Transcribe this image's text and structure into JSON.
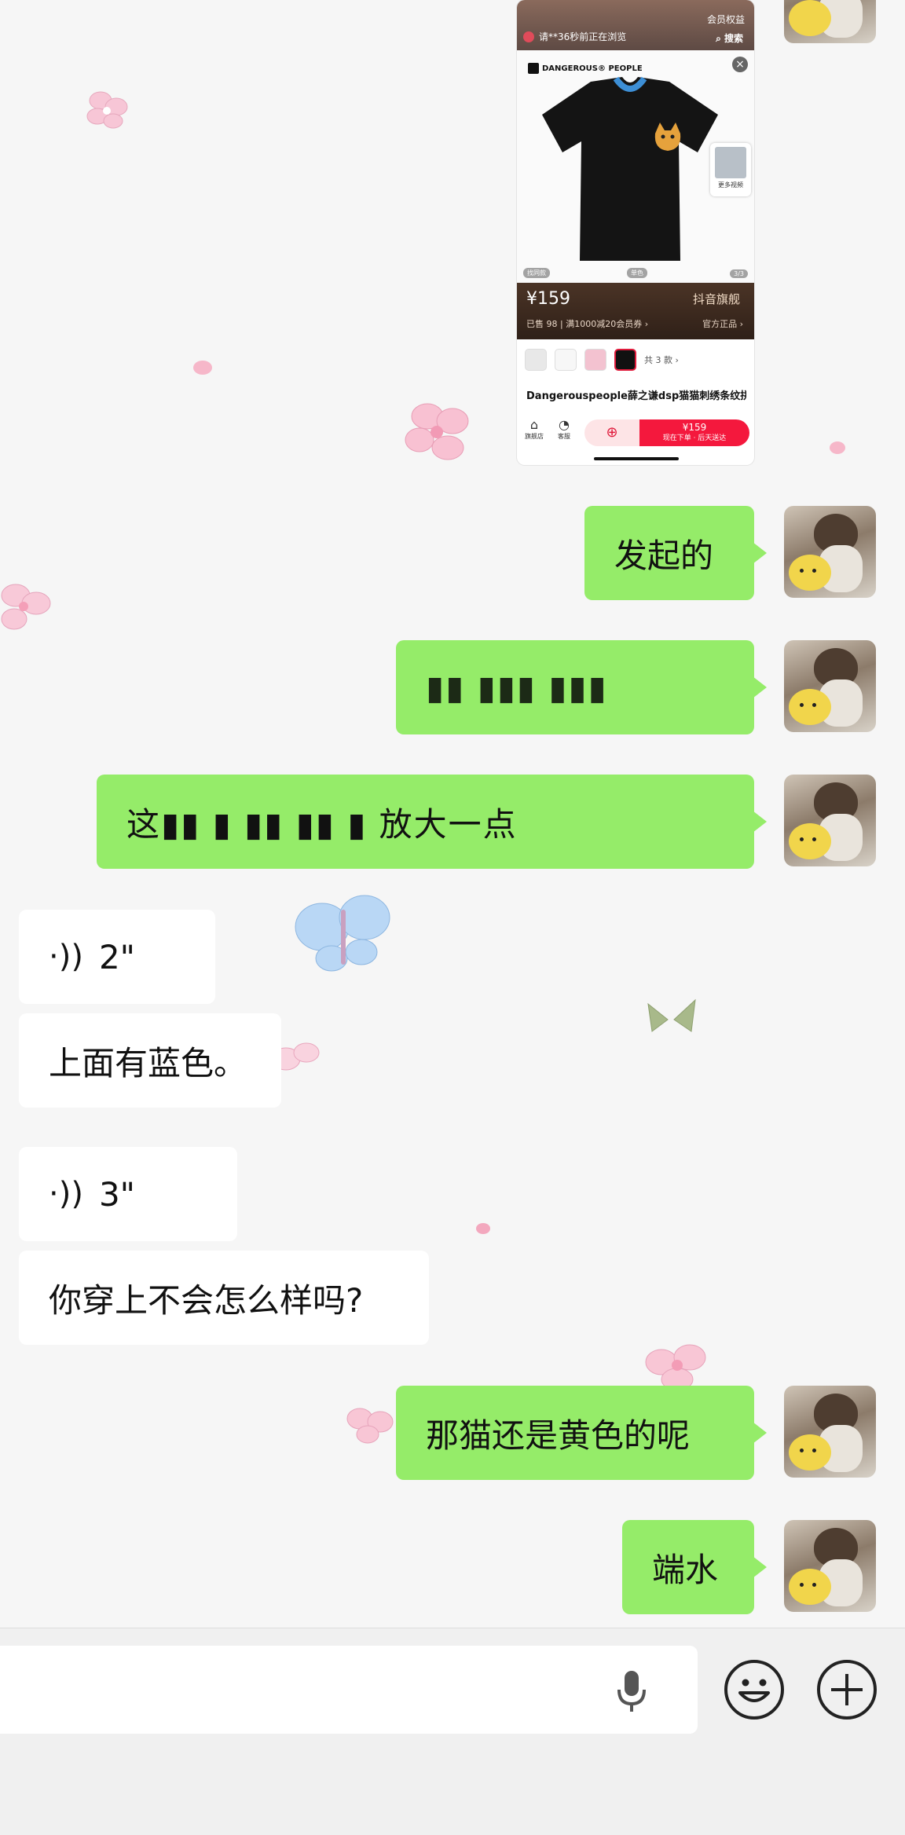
{
  "product_card": {
    "live_text": "请**36秒前正在浏览",
    "member_text": "会员权益",
    "search_label": "搜索",
    "brand": "DANGEROUS® PEOPLE",
    "more_videos": "更多视频",
    "image_footer_left": "找同款",
    "image_footer_mid": "单色",
    "image_index": "3/3",
    "price": "¥159",
    "sold": "已售 98",
    "promo": "满1000减20会员券",
    "store_flag": "抖音旗舰",
    "authentic": "官方正品",
    "color_count": "共 3 款",
    "title": "Dangerouspeople薛之谦dsp猫猫刺绣条纹拼接短袖男T恤",
    "store_label": "旗舰店",
    "service_label": "客服",
    "buy_price": "¥159",
    "buy_note": "现在下单 · 后天送达"
  },
  "messages": [
    {
      "type": "sent",
      "text": "发起的"
    },
    {
      "type": "sent",
      "text": "▮▮ ▮▮▮ ▮▮▮"
    },
    {
      "type": "sent",
      "text": "这▮▮ ▮ ▮▮ ▮▮ ▮ 放大一点"
    },
    {
      "type": "voice_received",
      "duration": "2\""
    },
    {
      "type": "received",
      "text": "上面有蓝色。"
    },
    {
      "type": "voice_received",
      "duration": "3\""
    },
    {
      "type": "received",
      "text": "你穿上不会怎么样吗?"
    },
    {
      "type": "sent",
      "text": "那猫还是黄色的呢"
    },
    {
      "type": "sent",
      "text": "端水"
    }
  ],
  "icons": {
    "voice": "voice-wave-icon",
    "mic": "microphone-icon",
    "emoji": "smiley-icon",
    "plus": "plus-icon"
  },
  "colors": {
    "sent_bubble": "#95ec69",
    "received_bubble": "#ffffff",
    "buy_button": "#f4183d"
  }
}
